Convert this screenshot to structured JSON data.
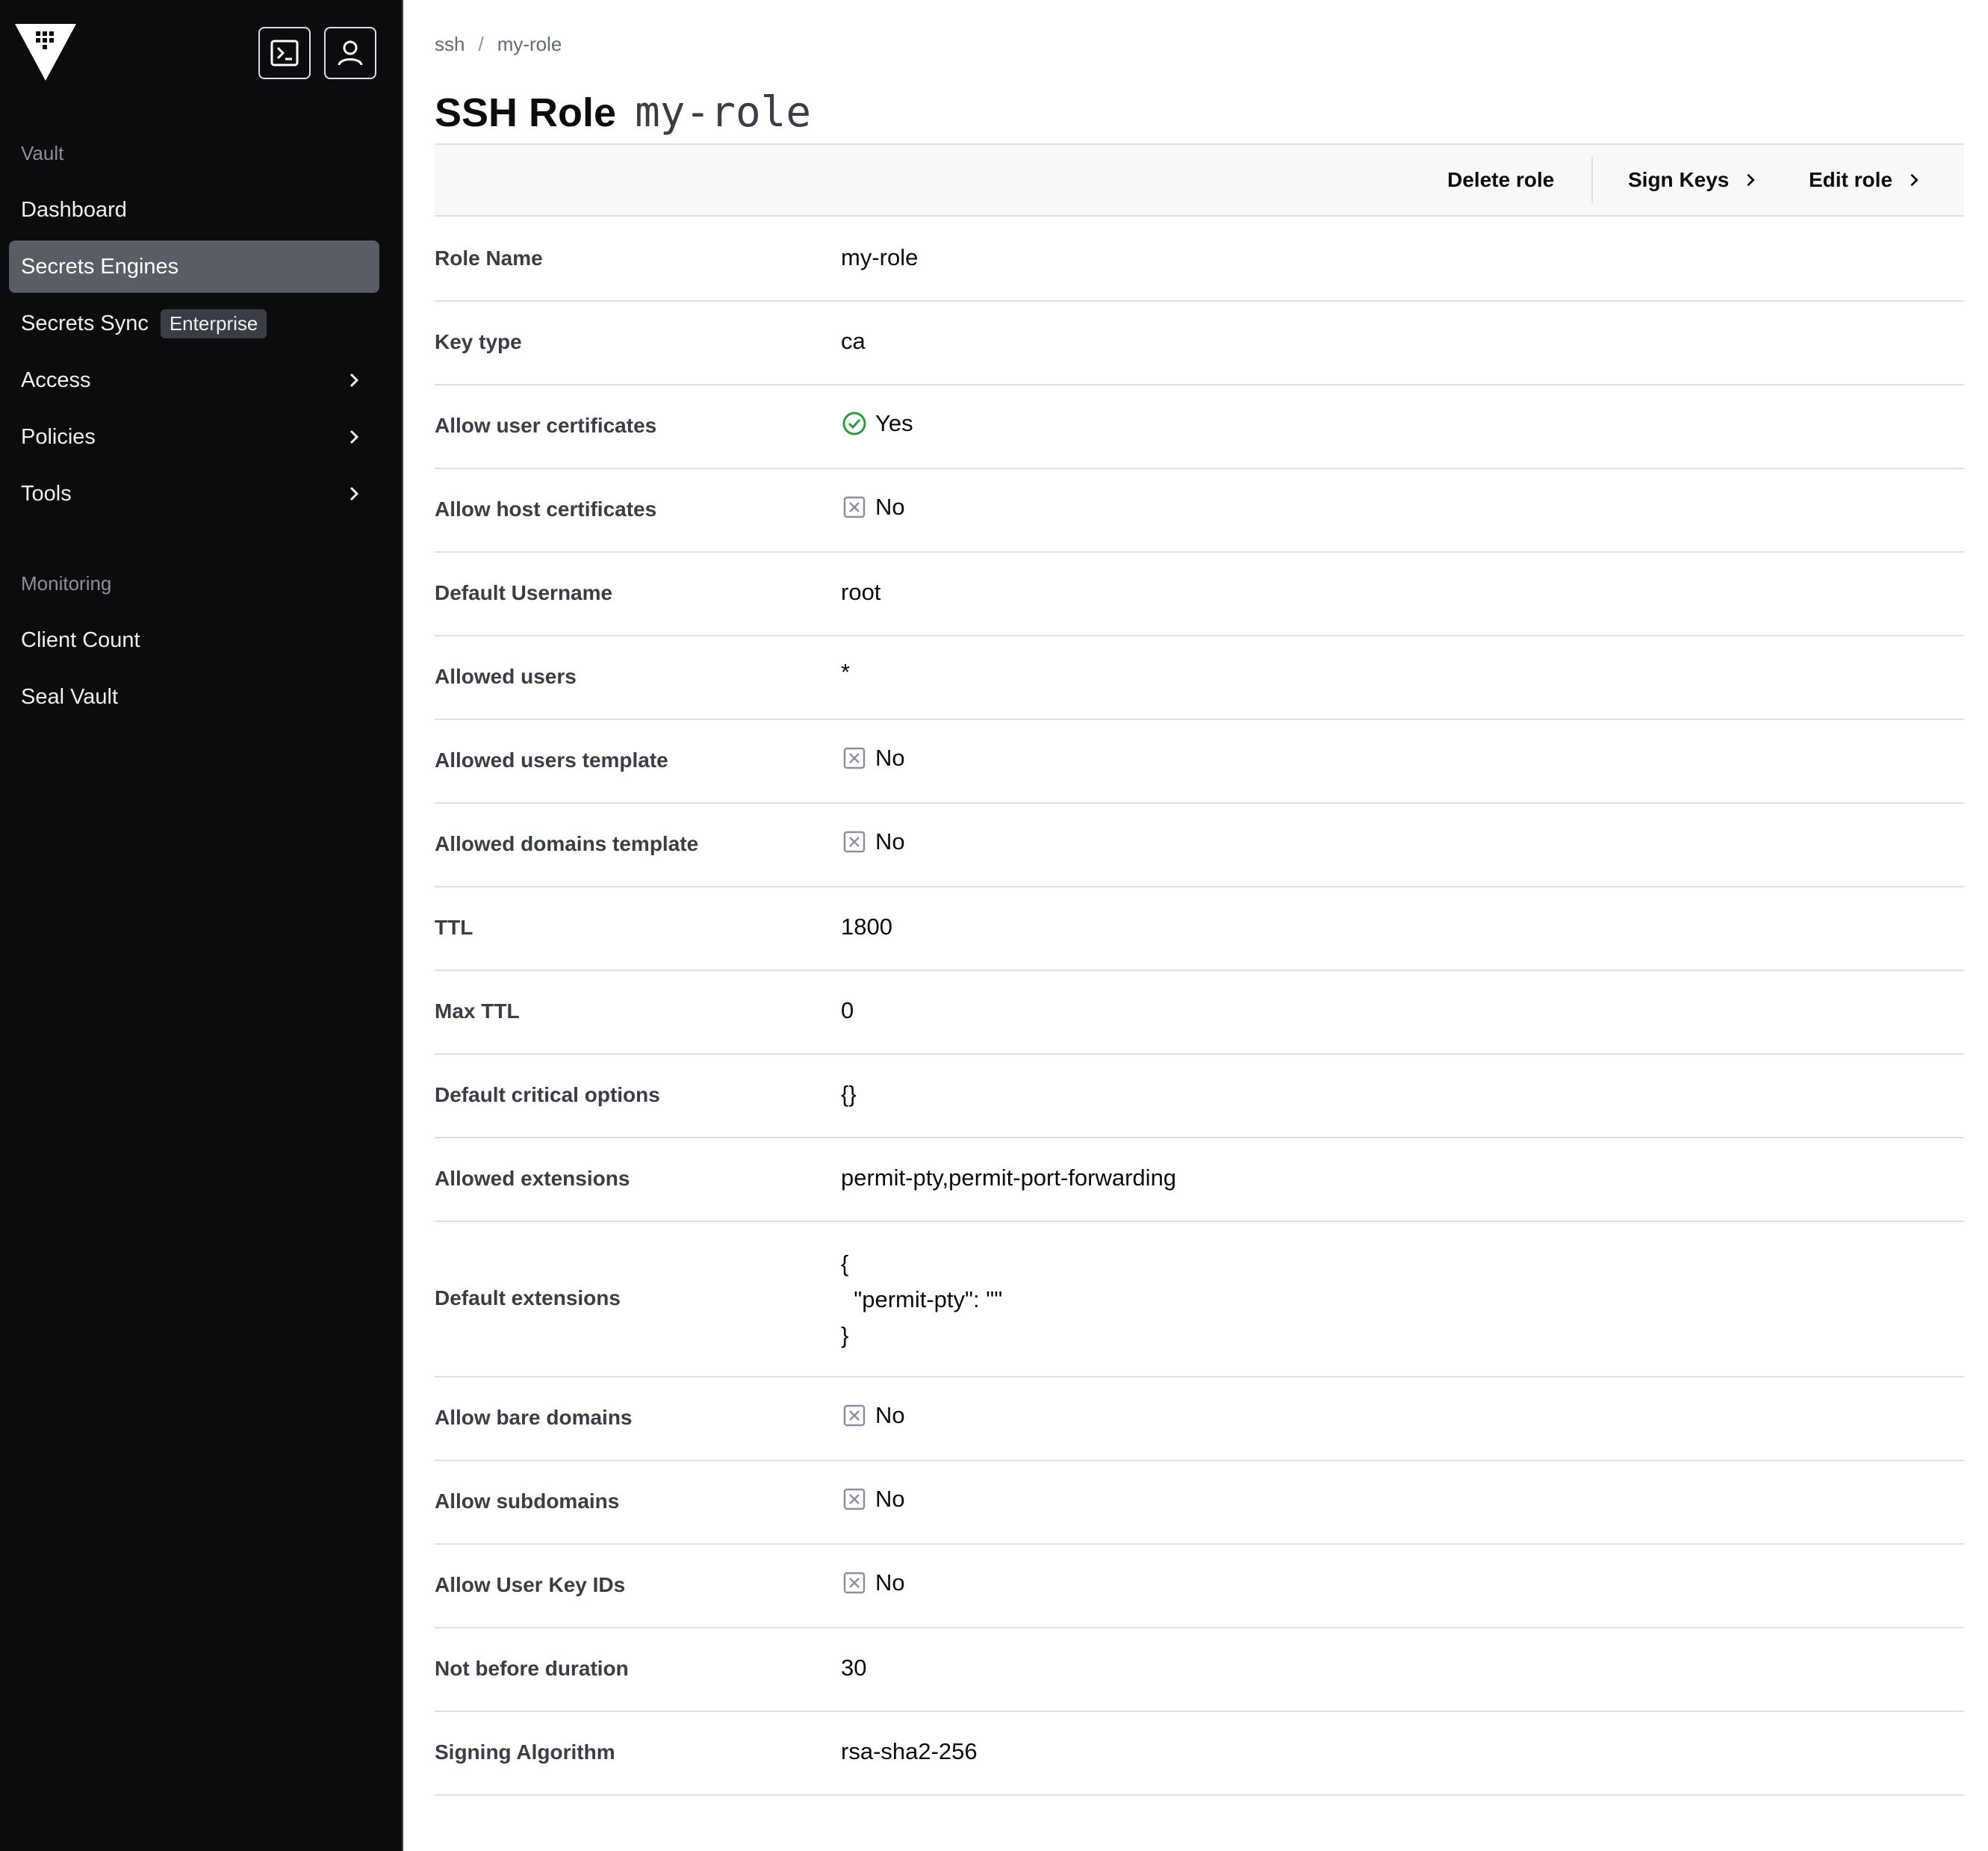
{
  "sidebar": {
    "section_vault": "Vault",
    "items": [
      {
        "label": "Dashboard"
      },
      {
        "label": "Secrets Engines"
      },
      {
        "label": "Secrets Sync",
        "badge": "Enterprise"
      },
      {
        "label": "Access"
      },
      {
        "label": "Policies"
      },
      {
        "label": "Tools"
      }
    ],
    "section_monitoring": "Monitoring",
    "monitoring_items": [
      {
        "label": "Client Count"
      },
      {
        "label": "Seal Vault"
      }
    ]
  },
  "breadcrumb": {
    "items": [
      "ssh",
      "my-role"
    ],
    "separator": "/"
  },
  "header": {
    "title": "SSH Role",
    "role_name": "my-role"
  },
  "toolbar": {
    "delete_label": "Delete role",
    "sign_label": "Sign Keys",
    "edit_label": "Edit role"
  },
  "details": [
    {
      "label": "Role Name",
      "value": "my-role"
    },
    {
      "label": "Key type",
      "value": "ca"
    },
    {
      "label": "Allow user certificates",
      "value": "Yes",
      "icon": "check-circle-icon"
    },
    {
      "label": "Allow host certificates",
      "value": "No",
      "icon": "x-square-icon"
    },
    {
      "label": "Default Username",
      "value": "root"
    },
    {
      "label": "Allowed users",
      "value": "*"
    },
    {
      "label": "Allowed users template",
      "value": "No",
      "icon": "x-square-icon"
    },
    {
      "label": "Allowed domains template",
      "value": "No",
      "icon": "x-square-icon"
    },
    {
      "label": "TTL",
      "value": "1800"
    },
    {
      "label": "Max TTL",
      "value": "0"
    },
    {
      "label": "Default critical options",
      "value": "{}"
    },
    {
      "label": "Allowed extensions",
      "value": "permit-pty,permit-port-forwarding"
    },
    {
      "label": "Default extensions",
      "value": "{\n  \"permit-pty\": \"\"\n}"
    },
    {
      "label": "Allow bare domains",
      "value": "No",
      "icon": "x-square-icon"
    },
    {
      "label": "Allow subdomains",
      "value": "No",
      "icon": "x-square-icon"
    },
    {
      "label": "Allow User Key IDs",
      "value": "No",
      "icon": "x-square-icon"
    },
    {
      "label": "Not before duration",
      "value": "30"
    },
    {
      "label": "Signing Algorithm",
      "value": "rsa-sha2-256"
    }
  ],
  "colors": {
    "sidebar_bg": "#0c0c0e",
    "active_item_bg": "#5b5d66",
    "success": "#2d9a3e",
    "muted_icon": "#8c909c"
  }
}
